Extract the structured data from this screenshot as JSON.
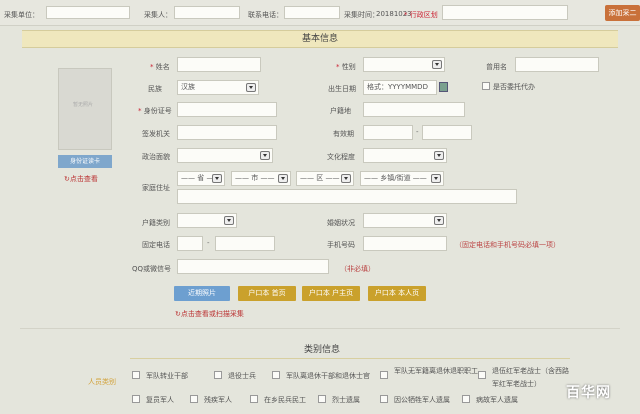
{
  "header": {
    "unit_label": "采集单位：",
    "collector_label": "采集人：",
    "phone_label": "联系电话：",
    "time_label": "采集时间：",
    "time_value": "20181023",
    "region_label": "* 行政区划",
    "add_button": "添加采二"
  },
  "basic": {
    "title": "基本信息",
    "photo_text": "暂无照片",
    "upload_btn": "身份证读卡",
    "click_view": "点击查看",
    "name_label": "姓名",
    "gender_label": "性别",
    "former_name_label": "曾用名",
    "ethnic_label": "民族",
    "ethnic_value": "汉族",
    "birth_label": "出生日期",
    "birth_placeholder": "格式：YYYYMMDD",
    "entrust_label": "是否委托代办",
    "id_label": "身份证号",
    "hukou_label": "户籍地",
    "issuer_label": "签发机关",
    "validity_label": "有效期",
    "validity_dash": "-",
    "political_label": "政治面貌",
    "education_label": "文化程度",
    "address_label": "家庭住址",
    "province": "—— 省 ——",
    "city": "—— 市 ——",
    "district": "—— 区 ——",
    "street": "—— 乡镇/街道 ——",
    "hukou_type_label": "户籍类别",
    "marital_label": "婚姻状况",
    "landline_label": "固定电话",
    "landline_dash": "-",
    "mobile_label": "手机号码",
    "phone_hint": "（固定电话和手机号码必填一项）",
    "qq_label": "QQ或微信号",
    "qq_hint": "（非必填）",
    "btn_photo": "近期照片",
    "btn_hukou_front": "户口本 首页",
    "btn_hukou_owner": "户口本 户主页",
    "btn_hukou_self": "户口本 本人页",
    "scan_link": "点击查看或扫描采集"
  },
  "category": {
    "title": "类别信息",
    "side_label": "人员类别",
    "items": [
      "军队转业干部",
      "退役士兵",
      "军队离退休干部和退休士官",
      "军队无军籍离退休退职职工",
      "退伍红军老战士（含西路军红军老战士）",
      "复员军人",
      "残疾军人",
      "在乡民兵民工",
      "烈士遗属",
      "因公牺牲军人遗属",
      "病故军人遗属"
    ]
  },
  "watermark": "百华网"
}
